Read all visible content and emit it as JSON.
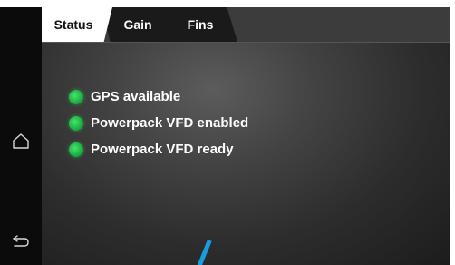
{
  "tabs": [
    {
      "label": "Status",
      "active": true
    },
    {
      "label": "Gain",
      "active": false
    },
    {
      "label": "Fins",
      "active": false
    }
  ],
  "status_items": [
    {
      "label": "GPS available",
      "state": "ok"
    },
    {
      "label": "Powerpack VFD enabled",
      "state": "ok"
    },
    {
      "label": "Powerpack VFD ready",
      "state": "ok"
    }
  ],
  "nav": {
    "home_icon": "home-icon",
    "back_icon": "back-icon"
  },
  "colors": {
    "status_ok": "#1fb245",
    "pointer": "#1a9ce0"
  }
}
